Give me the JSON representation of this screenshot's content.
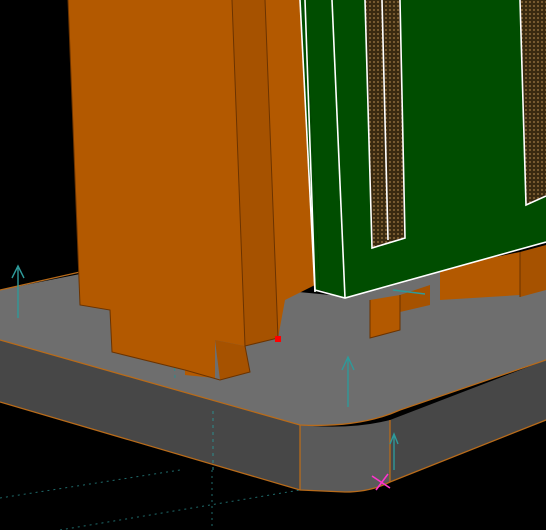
{
  "viewport": {
    "background": "#000000",
    "colors": {
      "copper_front": "#B35900",
      "copper_side": "#A65200",
      "copper_edge": "#6B3300",
      "board": "#004D00",
      "board_edge": "#FFFFFF",
      "base_top": "#6E6E6E",
      "base_side": "#474747",
      "base_corner": "#5A5A5A",
      "base_edge": "#B86B1A",
      "slot_dots": "#7A5A2A",
      "hidden_lines": "#2E8B8B",
      "normal_arrows": "#2E9A9A",
      "selection_point": "#FF0000",
      "origin_marker": "#FF33CC"
    },
    "icons": [
      "normal-arrow-icon",
      "origin-marker-icon",
      "selection-point-icon"
    ]
  }
}
